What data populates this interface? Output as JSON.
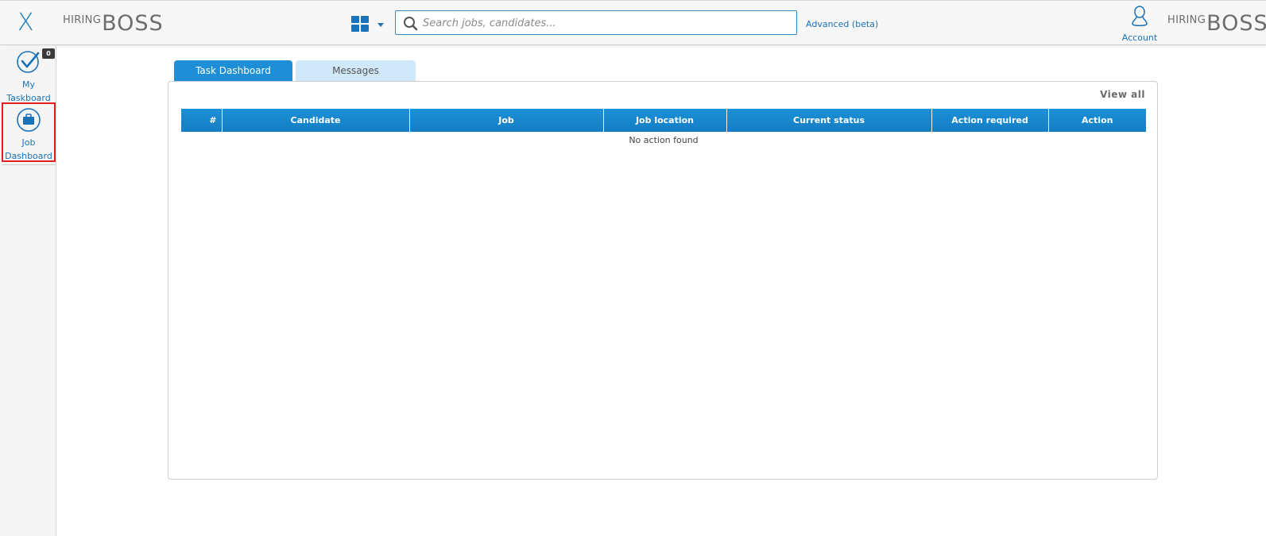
{
  "header": {
    "close_label": "X",
    "logo_left": {
      "hiring": "HIRING",
      "boss": "BOSS"
    },
    "logo_right": {
      "hiring": "HIRING",
      "boss": "BOSS"
    },
    "search": {
      "placeholder": "Search jobs, candidates..."
    },
    "advanced_link": "Advanced (beta)",
    "account_label": "Account"
  },
  "sidebar": {
    "items": [
      {
        "line1": "My",
        "line2": "Taskboard",
        "badge": "0",
        "icon": "check-circle-icon"
      },
      {
        "line1": "Job",
        "line2": "Dashboard",
        "icon": "briefcase-icon"
      }
    ]
  },
  "tabs": [
    {
      "label": "Task Dashboard",
      "active": true
    },
    {
      "label": "Messages",
      "active": false
    }
  ],
  "panel": {
    "view_all": "View all",
    "columns": [
      "#",
      "Candidate",
      "Job",
      "Job location",
      "Current status",
      "Action required",
      "Action"
    ],
    "empty_message": "No action found"
  },
  "colors": {
    "accent": "#1a72b9",
    "tab_active": "#1e8fd6",
    "tab_inactive": "#cfe9fa",
    "highlight_border": "#e02020"
  }
}
